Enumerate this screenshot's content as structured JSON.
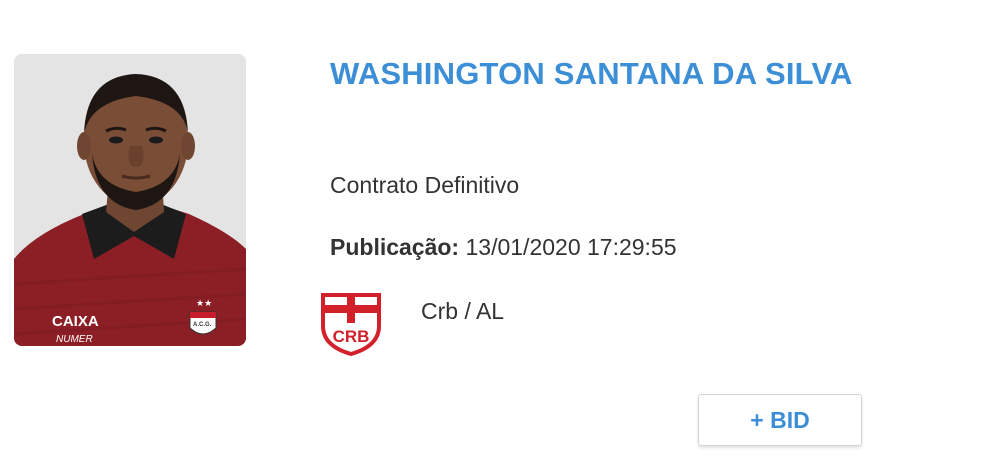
{
  "player": {
    "name": "WASHINGTON SANTANA DA SILVA",
    "photo_icon": "player-photo",
    "jersey_sponsor": "CAIXA",
    "jersey_sub_sponsor": "NUMER",
    "jersey_badge": "A.C.G."
  },
  "contract": {
    "type": "Contrato Definitivo",
    "publication_label": "Publicação:",
    "publication_value": "13/01/2020 17:29:55"
  },
  "club": {
    "name": "Crb / AL",
    "logo_text": "CRB",
    "logo_icon": "crb-shield-icon"
  },
  "actions": {
    "bid_label": "+ BID"
  },
  "colors": {
    "accent": "#3c8fd6",
    "text": "#333333",
    "club_red": "#d3212b",
    "jersey_red": "#8c1f26"
  }
}
